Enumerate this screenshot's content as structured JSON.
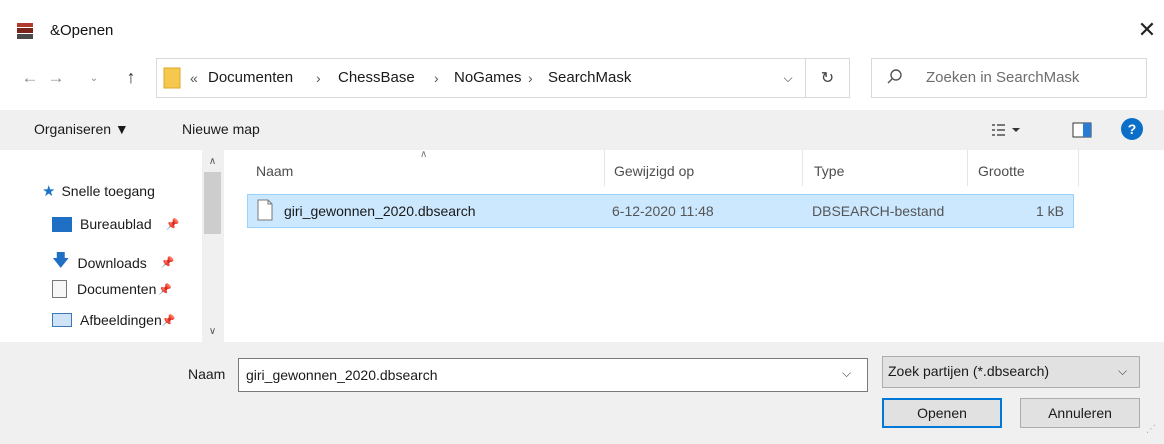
{
  "window": {
    "title": "&Openen",
    "close_symbol": "✕"
  },
  "address": {
    "breadcrumbs": [
      "Documenten",
      "ChessBase",
      "NoGames",
      "SearchMask"
    ],
    "overflow_symbol": "«"
  },
  "search": {
    "placeholder": "Zoeken in SearchMask"
  },
  "toolbar": {
    "organise_label": "Organiseren ▼",
    "new_folder_label": "Nieuwe map",
    "help_symbol": "?"
  },
  "nav": {
    "quick_access": "Snelle toegang",
    "items": [
      {
        "label": "Bureaublad",
        "icon": "desktop-icon",
        "pinned": true
      },
      {
        "label": "Downloads",
        "icon": "download-icon",
        "pinned": true
      },
      {
        "label": "Documenten",
        "icon": "document-icon",
        "pinned": true
      },
      {
        "label": "Afbeeldingen",
        "icon": "image-icon",
        "pinned": true
      }
    ]
  },
  "columns": {
    "name": "Naam",
    "modified": "Gewijzigd op",
    "type": "Type",
    "size": "Grootte"
  },
  "files": [
    {
      "name": "giri_gewonnen_2020.dbsearch",
      "modified": "6-12-2020 11:48",
      "type": "DBSEARCH-bestand",
      "size": "1 kB",
      "selected": true
    }
  ],
  "bottom": {
    "name_label": "Naam",
    "name_value": "giri_gewonnen_2020.dbsearch",
    "filter_value": "Zoek partijen (*.dbsearch)",
    "open_label": "Openen",
    "cancel_label": "Annuleren"
  },
  "colors": {
    "selection_bg": "#cce8ff",
    "selection_border": "#99d1ff",
    "accent": "#0078d7"
  }
}
